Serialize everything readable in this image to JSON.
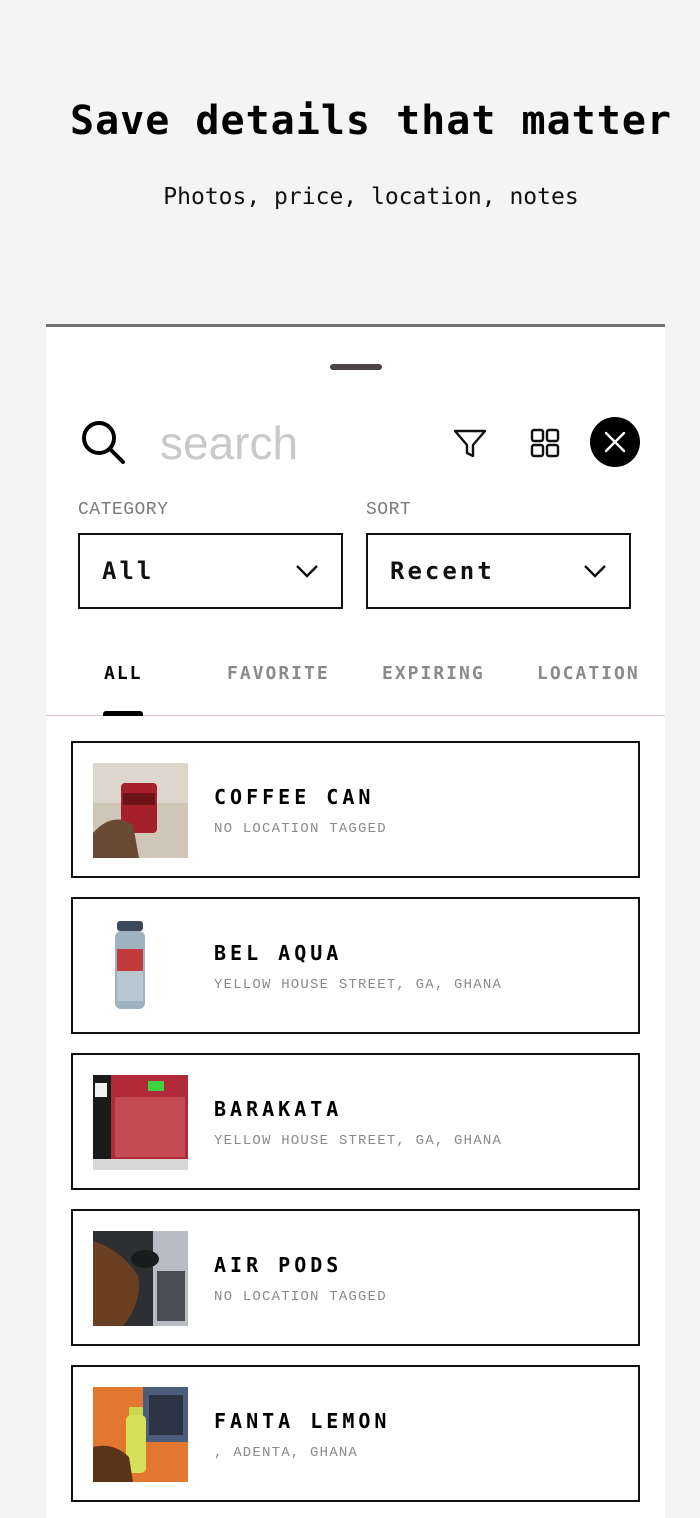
{
  "hero": {
    "title": "Save details that matter",
    "subtitle": "Photos, price, location, notes"
  },
  "search": {
    "placeholder": "search"
  },
  "icons": {
    "search": "search-icon",
    "filter": "filter-icon",
    "grid": "grid-view-icon",
    "close": "close-icon",
    "chevron": "chevron-down-icon"
  },
  "filters": {
    "category_label": "CATEGORY",
    "category_value": "All",
    "sort_label": "SORT",
    "sort_value": "Recent"
  },
  "tabs": [
    {
      "label": "ALL",
      "active": true
    },
    {
      "label": "FAVORITE",
      "active": false
    },
    {
      "label": "EXPIRING",
      "active": false
    },
    {
      "label": "LOCATION",
      "active": false
    }
  ],
  "items": [
    {
      "name": "COFFEE CAN",
      "location": "NO LOCATION TAGGED",
      "thumb": "photo-coffee-can"
    },
    {
      "name": "BEL AQUA",
      "location": "YELLOW HOUSE STREET, GA, GHANA",
      "thumb": "photo-water-bottle"
    },
    {
      "name": "BARAKATA",
      "location": "YELLOW HOUSE STREET, GA, GHANA",
      "thumb": "photo-barakata-box"
    },
    {
      "name": "AIR PODS",
      "location": "NO LOCATION TAGGED",
      "thumb": "photo-air-pods"
    },
    {
      "name": "FANTA LEMON",
      "location": ", ADENTA, GHANA",
      "thumb": "photo-fanta-bottle"
    }
  ],
  "colors": {
    "background": "#f4f4f4",
    "sheet": "#ffffff",
    "accent": "#000000",
    "muted_text": "#8a8a8a",
    "handle": "#4a4347"
  }
}
